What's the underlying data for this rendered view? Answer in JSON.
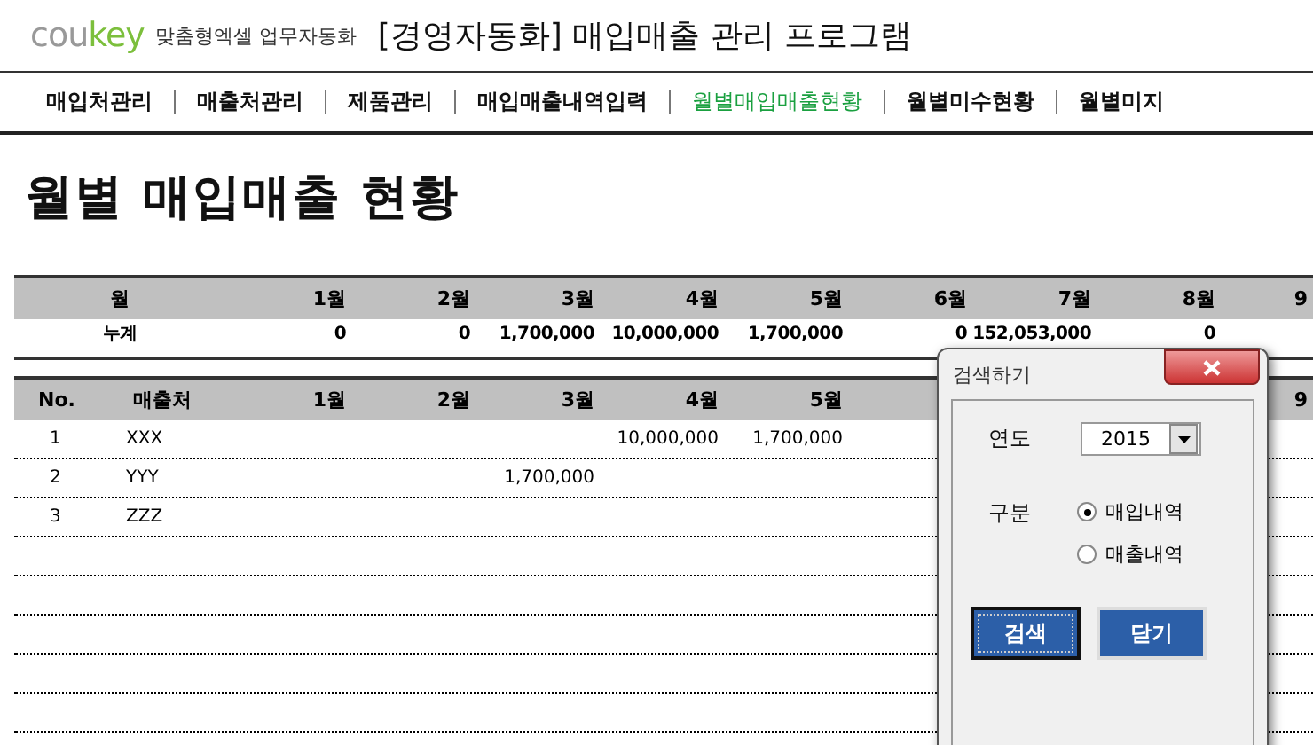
{
  "header": {
    "logo": [
      {
        "text": "cou",
        "color": "#999999"
      },
      {
        "text": "key",
        "color": "#7cbf3c"
      }
    ],
    "tagline": "맞춤형엑셀 업무자동화",
    "title": "[경영자동화] 매입매출 관리 프로그램"
  },
  "nav": [
    {
      "label": "매입처관리",
      "selected": false
    },
    {
      "label": "매출처관리",
      "selected": false
    },
    {
      "label": "제품관리",
      "selected": false
    },
    {
      "label": "매입매출내역입력",
      "selected": false
    },
    {
      "label": "월별매입매출현황",
      "selected": true
    },
    {
      "label": "월별미수현황",
      "selected": false
    },
    {
      "label": "월별미지",
      "selected": false
    }
  ],
  "page_title": "월별 매입매출 현황",
  "summary": {
    "columns": [
      "월",
      "1월",
      "2월",
      "3월",
      "4월",
      "5월",
      "6월",
      "7월",
      "8월",
      "9"
    ],
    "rows": [
      {
        "label": "누계",
        "values": [
          "0",
          "0",
          "1,700,000",
          "10,000,000",
          "1,700,000",
          "0",
          "152,053,000",
          "0"
        ]
      }
    ]
  },
  "detail": {
    "columns": [
      "No.",
      "매출처",
      "1월",
      "2월",
      "3월",
      "4월",
      "5월",
      "9"
    ],
    "rows": [
      {
        "no": "1",
        "name": "XXX",
        "amounts": {
          "4": "10,000,000",
          "5": "1,700,000"
        }
      },
      {
        "no": "2",
        "name": "YYY",
        "amounts": {
          "3": "1,700,000"
        }
      },
      {
        "no": "3",
        "name": "ZZZ",
        "amounts": {}
      }
    ]
  },
  "dialog": {
    "title": "검색하기",
    "year_label": "연도",
    "year": "2015",
    "type_label": "구분",
    "options": [
      {
        "label": "매입내역",
        "selected": true
      },
      {
        "label": "매출내역",
        "selected": false
      }
    ],
    "buttons": [
      {
        "label": "검색",
        "focused": true
      },
      {
        "label": "닫기",
        "focused": false
      }
    ]
  }
}
